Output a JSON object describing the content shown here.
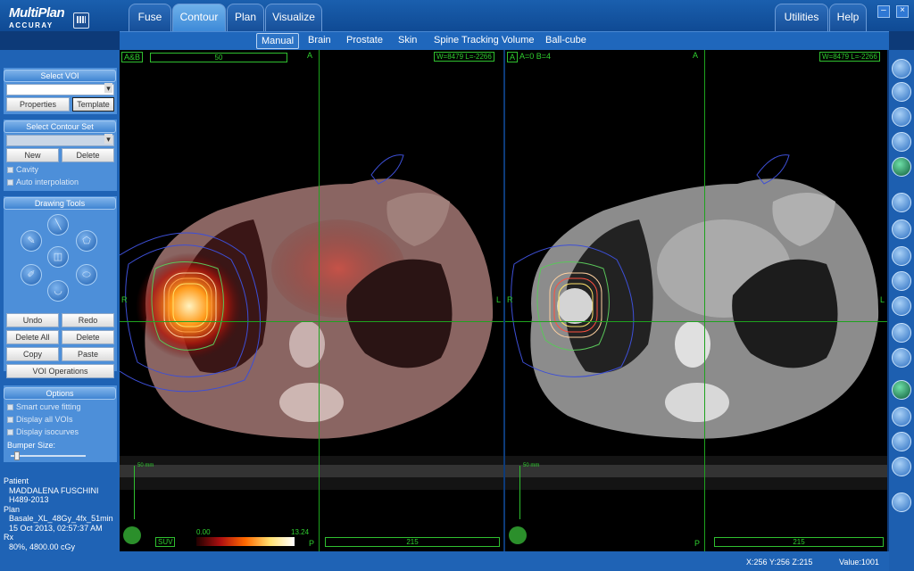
{
  "app": {
    "name_line1": "MultiPlan",
    "name_line2": "ACCURAY"
  },
  "tabs": [
    {
      "label": "Fuse",
      "active": false
    },
    {
      "label": "Contour",
      "active": true
    },
    {
      "label": "Plan",
      "active": false
    },
    {
      "label": "Visualize",
      "active": false
    }
  ],
  "right_tabs": [
    {
      "label": "Utilities"
    },
    {
      "label": "Help"
    }
  ],
  "window_buttons": {
    "minimize": "–",
    "close": "×"
  },
  "subtabs": [
    {
      "label": "Manual",
      "active": true
    },
    {
      "label": "Brain",
      "active": false
    },
    {
      "label": "Prostate",
      "active": false
    },
    {
      "label": "Skin",
      "active": false
    },
    {
      "label": "Spine Tracking Volume",
      "active": false
    },
    {
      "label": "Ball-cube",
      "active": false
    }
  ],
  "left_panel": {
    "select_voi": {
      "title": "Select VOI",
      "value": "",
      "properties": "Properties",
      "template": "Template"
    },
    "contour_set": {
      "title": "Select Contour Set",
      "value": "",
      "new": "New",
      "delete": "Delete",
      "cavity": "Cavity",
      "auto_interp": "Auto interpolation"
    },
    "drawing_tools": {
      "title": "Drawing Tools",
      "tools": [
        "line-tool-icon",
        "pencil-tool-icon",
        "polygon-tool-icon",
        "brush-tool-icon",
        "cube-tool-icon",
        "ellipse-tool-icon",
        "lasso-tool-icon"
      ]
    },
    "edit_buttons": {
      "undo": "Undo",
      "redo": "Redo",
      "delete_all": "Delete All",
      "delete": "Delete",
      "copy": "Copy",
      "paste": "Paste",
      "voi_ops": "VOI Operations"
    },
    "options": {
      "title": "Options",
      "smart_curve": "Smart curve fitting",
      "display_vois": "Display all VOIs",
      "display_iso": "Display isocurves",
      "bumper": "Bumper Size:",
      "bumper_level": 0.05
    }
  },
  "patient": {
    "patient_label": "Patient",
    "patient_name": "MADDALENA FUSCHINI",
    "patient_id": "H489-2013",
    "plan_label": "Plan",
    "plan_name": "Basale_XL_48Gy_4fx_51min",
    "plan_date": "15 Oct 2013, 02:57:37 AM",
    "rx_label": "Rx",
    "rx_value": "80%, 4800.00 cGy"
  },
  "viewport_left": {
    "label": "A&B",
    "slider_value": "50",
    "window_level": "W=8479 L=-2266",
    "orient_top": "A",
    "orient_left": "R",
    "orient_right": "L",
    "orient_bottom": "P",
    "scalebar": "50 mm",
    "suv": "SUV",
    "scale_min": "0.00",
    "scale_max": "13.24",
    "slice": "215"
  },
  "viewport_right": {
    "label": "A",
    "blend": "A=0 B=4",
    "window_level": "W=8479 L=-2266",
    "orient_top": "A",
    "orient_left": "R",
    "orient_right": "L",
    "orient_bottom": "P",
    "scalebar": "50 mm",
    "slice": "215"
  },
  "status": {
    "coords": "X:256 Y:256 Z:215",
    "value": "Value:1001"
  },
  "colors": {
    "accent": "#3d8ad8",
    "crosshair": "#1ea21e"
  }
}
